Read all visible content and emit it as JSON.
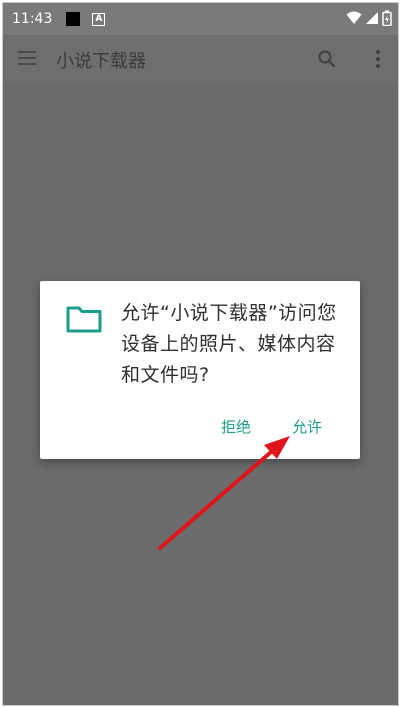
{
  "status_bar": {
    "time": "11:43",
    "notification_badge": "A",
    "icons": [
      "wifi-icon",
      "signal-icon",
      "battery-icon"
    ]
  },
  "app_bar": {
    "title": "小说下载器",
    "icons": [
      "menu-icon",
      "search-icon",
      "more-vert-icon"
    ]
  },
  "dialog": {
    "icon": "folder-icon",
    "message": "允许“小说下载器”访问您设备上的照片、媒体内容和文件吗?",
    "deny_label": "拒绝",
    "allow_label": "允许",
    "accent_color": "#1c9c8c"
  },
  "annotation": {
    "type": "arrow",
    "color": "#e0141b",
    "points_to": "allow-button"
  },
  "colors": {
    "scrim": "#6b6b6b",
    "dialog_background": "#ffffff",
    "text": "#303030"
  }
}
